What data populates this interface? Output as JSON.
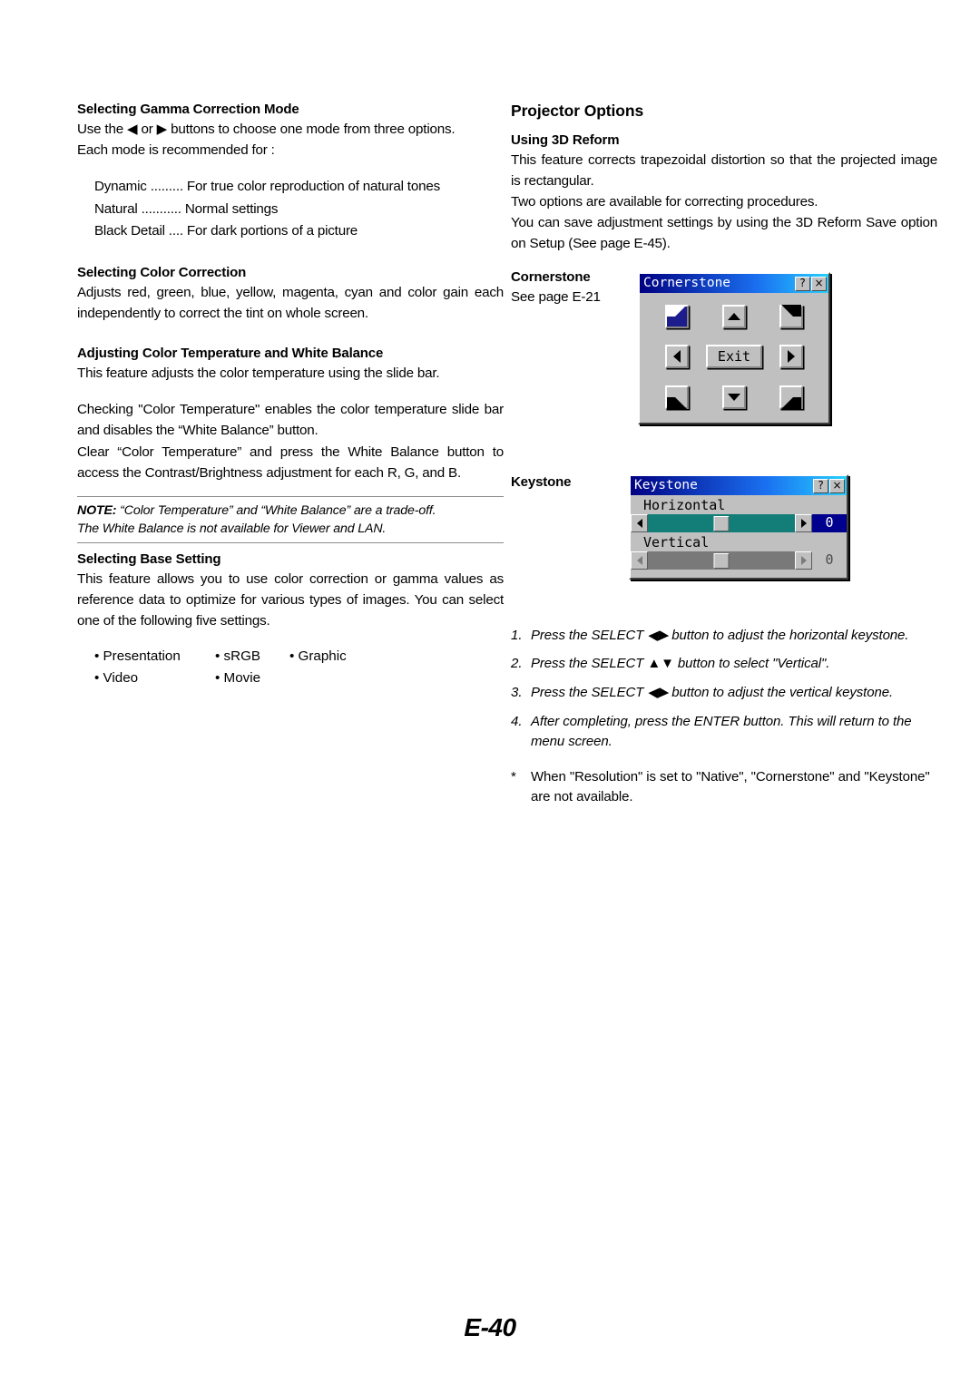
{
  "left_column": {
    "gamma": {
      "heading": "Selecting Gamma Correction Mode",
      "intro_line1": "Use the ◀ or ▶ buttons to choose one mode from three options.",
      "intro_line2": "Each mode is recommended for :",
      "modes": [
        "Dynamic ......... For true color reproduction of natural tones",
        "Natural ........... Normal settings",
        "Black Detail .... For dark portions of a picture"
      ]
    },
    "color_correction": {
      "heading": "Selecting Color Correction",
      "body": "Adjusts red, green, blue, yellow, magenta, cyan and color gain each independently to correct the tint on whole screen."
    },
    "color_temperature": {
      "heading": "Adjusting Color Temperature and White Balance",
      "body": "This feature adjusts the color temperature using the slide bar.",
      "para2": "Checking \"Color Temperature\" enables the color temperature slide bar and disables the “White Balance” button.",
      "para3": "Clear “Color Temperature” and press the White Balance button to access the Contrast/Brightness adjustment for each R, G, and B."
    },
    "note": {
      "label": "NOTE:",
      "line1": " “Color Temperature” and “White Balance” are a trade-off.",
      "line2": "The White Balance is not available for Viewer and LAN."
    },
    "base_setting": {
      "heading": "Selecting Base Setting",
      "body": "This feature allows you to use color correction or gamma values as reference data to optimize for various types of images. You can select one of the following five settings.",
      "options_row1": [
        "• Presentation",
        "• sRGB",
        "• Graphic"
      ],
      "options_row2": [
        "• Video",
        "• Movie",
        ""
      ]
    }
  },
  "right_column": {
    "section_title": "Projector Options",
    "reform": {
      "heading": "Using 3D Reform",
      "para1": "This feature corrects trapezoidal distortion so that the projected image is rectangular.",
      "para2": "Two options are available for correcting procedures.",
      "para3": "You can save adjustment settings by using the 3D Reform Save option on Setup (See page E-45)."
    },
    "cornerstone": {
      "heading": "Cornerstone",
      "see_page": "See page E-21"
    },
    "keystone": {
      "heading": "Keystone"
    },
    "steps": [
      {
        "num": "1.",
        "text": "Press the SELECT ◀▶ button to adjust the horizontal keystone."
      },
      {
        "num": "2.",
        "text": "Press the SELECT ▲▼ button to select \"Vertical\"."
      },
      {
        "num": "3.",
        "text": "Press the SELECT ◀▶ button to adjust the vertical keystone."
      },
      {
        "num": "4.",
        "text": "After completing, press the ENTER button. This will return to the menu screen."
      }
    ],
    "star_note": {
      "marker": "*",
      "text": "When \"Resolution\" is set to \"Native\", \"Cornerstone\" and \"Keystone\" are not available."
    }
  },
  "cornerstone_dialog": {
    "title": "Cornerstone",
    "help_button": "?",
    "close_button": "×",
    "exit_button": "Exit",
    "selected_cell": "top-left"
  },
  "keystone_dialog": {
    "title": "Keystone",
    "help_button": "?",
    "close_button": "×",
    "horizontal_label": "Horizontal",
    "horizontal_value": "0",
    "vertical_label": "Vertical",
    "vertical_value": "0"
  },
  "footer": {
    "page_number": "E-40"
  },
  "colors": {
    "titlebar_start": "#000082",
    "titlebar_end": "#27d0ff",
    "dialog_face": "#c0c0c0",
    "selected_cell": "#1c1c8c",
    "active_slider_track": "#137d78",
    "active_row_background": "#00008f",
    "inactive_slider_track": "#797979"
  }
}
